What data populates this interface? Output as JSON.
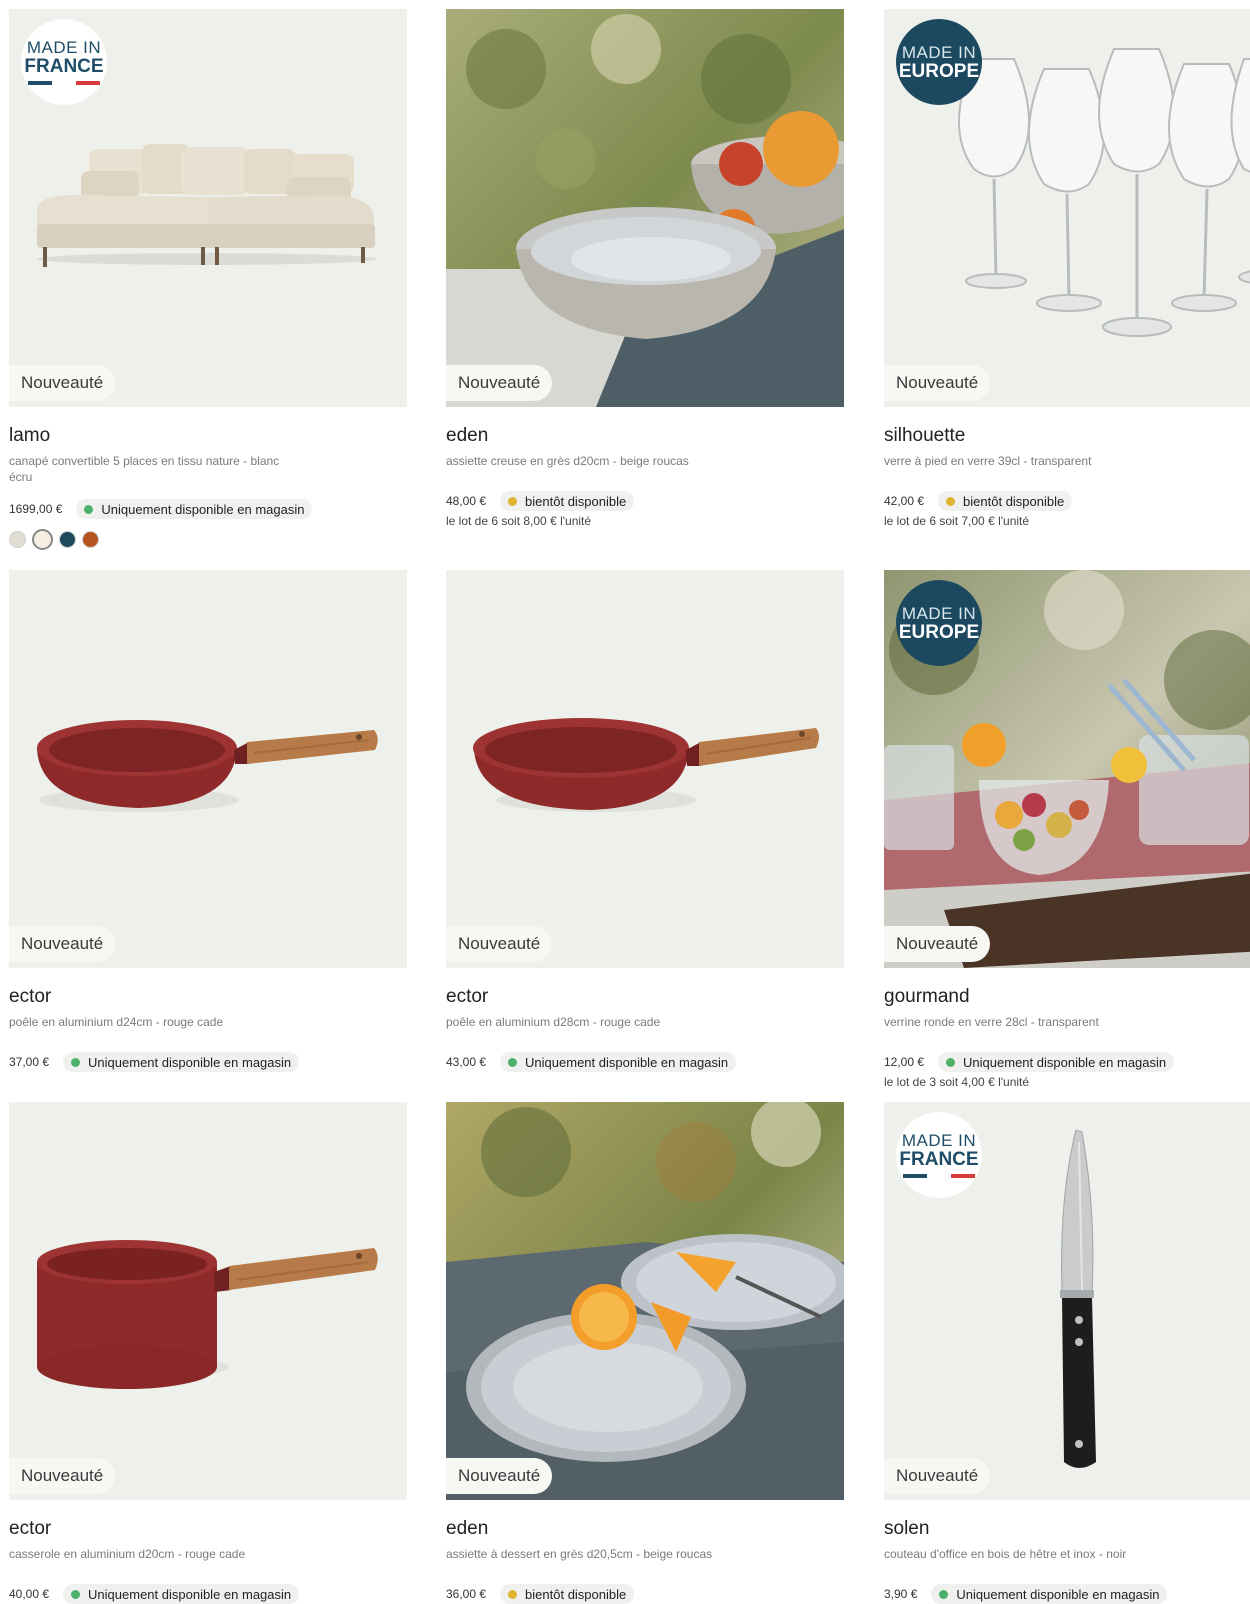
{
  "badge_new": "Nouveauté",
  "made_in": {
    "france": {
      "l1": "MADE IN",
      "l2": "FRANCE"
    },
    "europe": {
      "l1": "MADE IN",
      "l2": "EUROPE"
    }
  },
  "colors": {
    "available_store": "#4caf6a",
    "coming_soon": "#e0b331",
    "pan_red": "#8e2a2a",
    "wood": "#b77b49",
    "badge_blue": "#1c4960"
  },
  "products": [
    {
      "name": "lamo",
      "desc": "canapé convertible 5 places en tissu nature - blanc écru",
      "price": "1699,00 €",
      "availability": "Uniquement disponible en magasin",
      "swatches": [
        "#e2ddd3",
        "#f6eee2",
        "#1f4a5e",
        "#b5531e"
      ],
      "image": "sofa-image"
    },
    {
      "name": "eden",
      "desc": "assiette creuse en grès d20cm - beige roucas",
      "price": "48,00 €",
      "availability": "bientôt disponible",
      "lot": "le lot de 6 soit 8,00 € l'unité",
      "image": "bowl-image"
    },
    {
      "name": "silhouette",
      "desc": "verre à pied en verre 39cl - transparent",
      "price": "42,00 €",
      "availability": "bientôt disponible",
      "lot": "le lot de 6 soit 7,00 € l'unité",
      "image": "wine-glasses-image"
    },
    {
      "name": "ector",
      "desc": "poêle en aluminium d24cm - rouge cade",
      "price": "37,00 €",
      "availability": "Uniquement disponible en magasin",
      "image": "frying-pan-image"
    },
    {
      "name": "ector",
      "desc": "poêle en aluminium d28cm - rouge cade",
      "price": "43,00 €",
      "availability": "Uniquement disponible en magasin",
      "image": "frying-pan-image"
    },
    {
      "name": "gourmand",
      "desc": "verrine ronde en verre 28cl - transparent",
      "price": "12,00 €",
      "availability": "Uniquement disponible en magasin",
      "lot": "le lot de 3 soit 4,00 € l'unité",
      "image": "verrine-image"
    },
    {
      "name": "ector",
      "desc": "casserole en aluminium d20cm - rouge cade",
      "price": "40,00 €",
      "availability": "Uniquement disponible en magasin",
      "image": "saucepan-image"
    },
    {
      "name": "eden",
      "desc": "assiette à dessert en grès d20,5cm - beige roucas",
      "price": "36,00 €",
      "availability": "bientôt disponible",
      "image": "dessert-plate-image"
    },
    {
      "name": "solen",
      "desc": "couteau d'office en bois de hêtre et inox - noir",
      "price": "3,90 €",
      "availability": "Uniquement disponible en magasin",
      "image": "knife-image"
    }
  ]
}
